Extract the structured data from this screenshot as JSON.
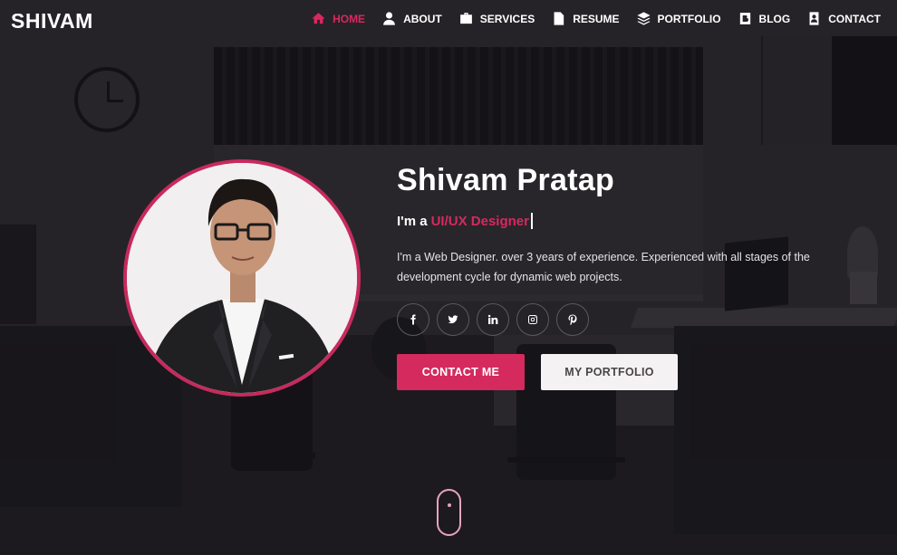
{
  "brand": {
    "name": "SHIVAM"
  },
  "nav": {
    "items": [
      {
        "label": "HOME",
        "icon": "home-icon",
        "active": true
      },
      {
        "label": "ABOUT",
        "icon": "user-icon",
        "active": false
      },
      {
        "label": "SERVICES",
        "icon": "briefcase-icon",
        "active": false
      },
      {
        "label": "RESUME",
        "icon": "file-icon",
        "active": false
      },
      {
        "label": "PORTFOLIO",
        "icon": "layers-icon",
        "active": false
      },
      {
        "label": "BLOG",
        "icon": "blog-icon",
        "active": false
      },
      {
        "label": "CONTACT",
        "icon": "contact-card-icon",
        "active": false
      }
    ]
  },
  "hero": {
    "name": "Shivam Pratap",
    "role_prefix": "I'm a",
    "role_typed": "UI/UX Designer",
    "description": "I'm a Web Designer. over 3 years of experience. Experienced with all stages of the development cycle for dynamic web projects.",
    "socials": [
      "facebook-icon",
      "twitter-icon",
      "linkedin-icon",
      "instagram-icon",
      "pinterest-icon"
    ],
    "primary_button": "CONTACT ME",
    "secondary_button": "MY PORTFOLIO"
  },
  "colors": {
    "accent": "#d52a5e",
    "background": "#242126",
    "text": "#ffffff"
  }
}
